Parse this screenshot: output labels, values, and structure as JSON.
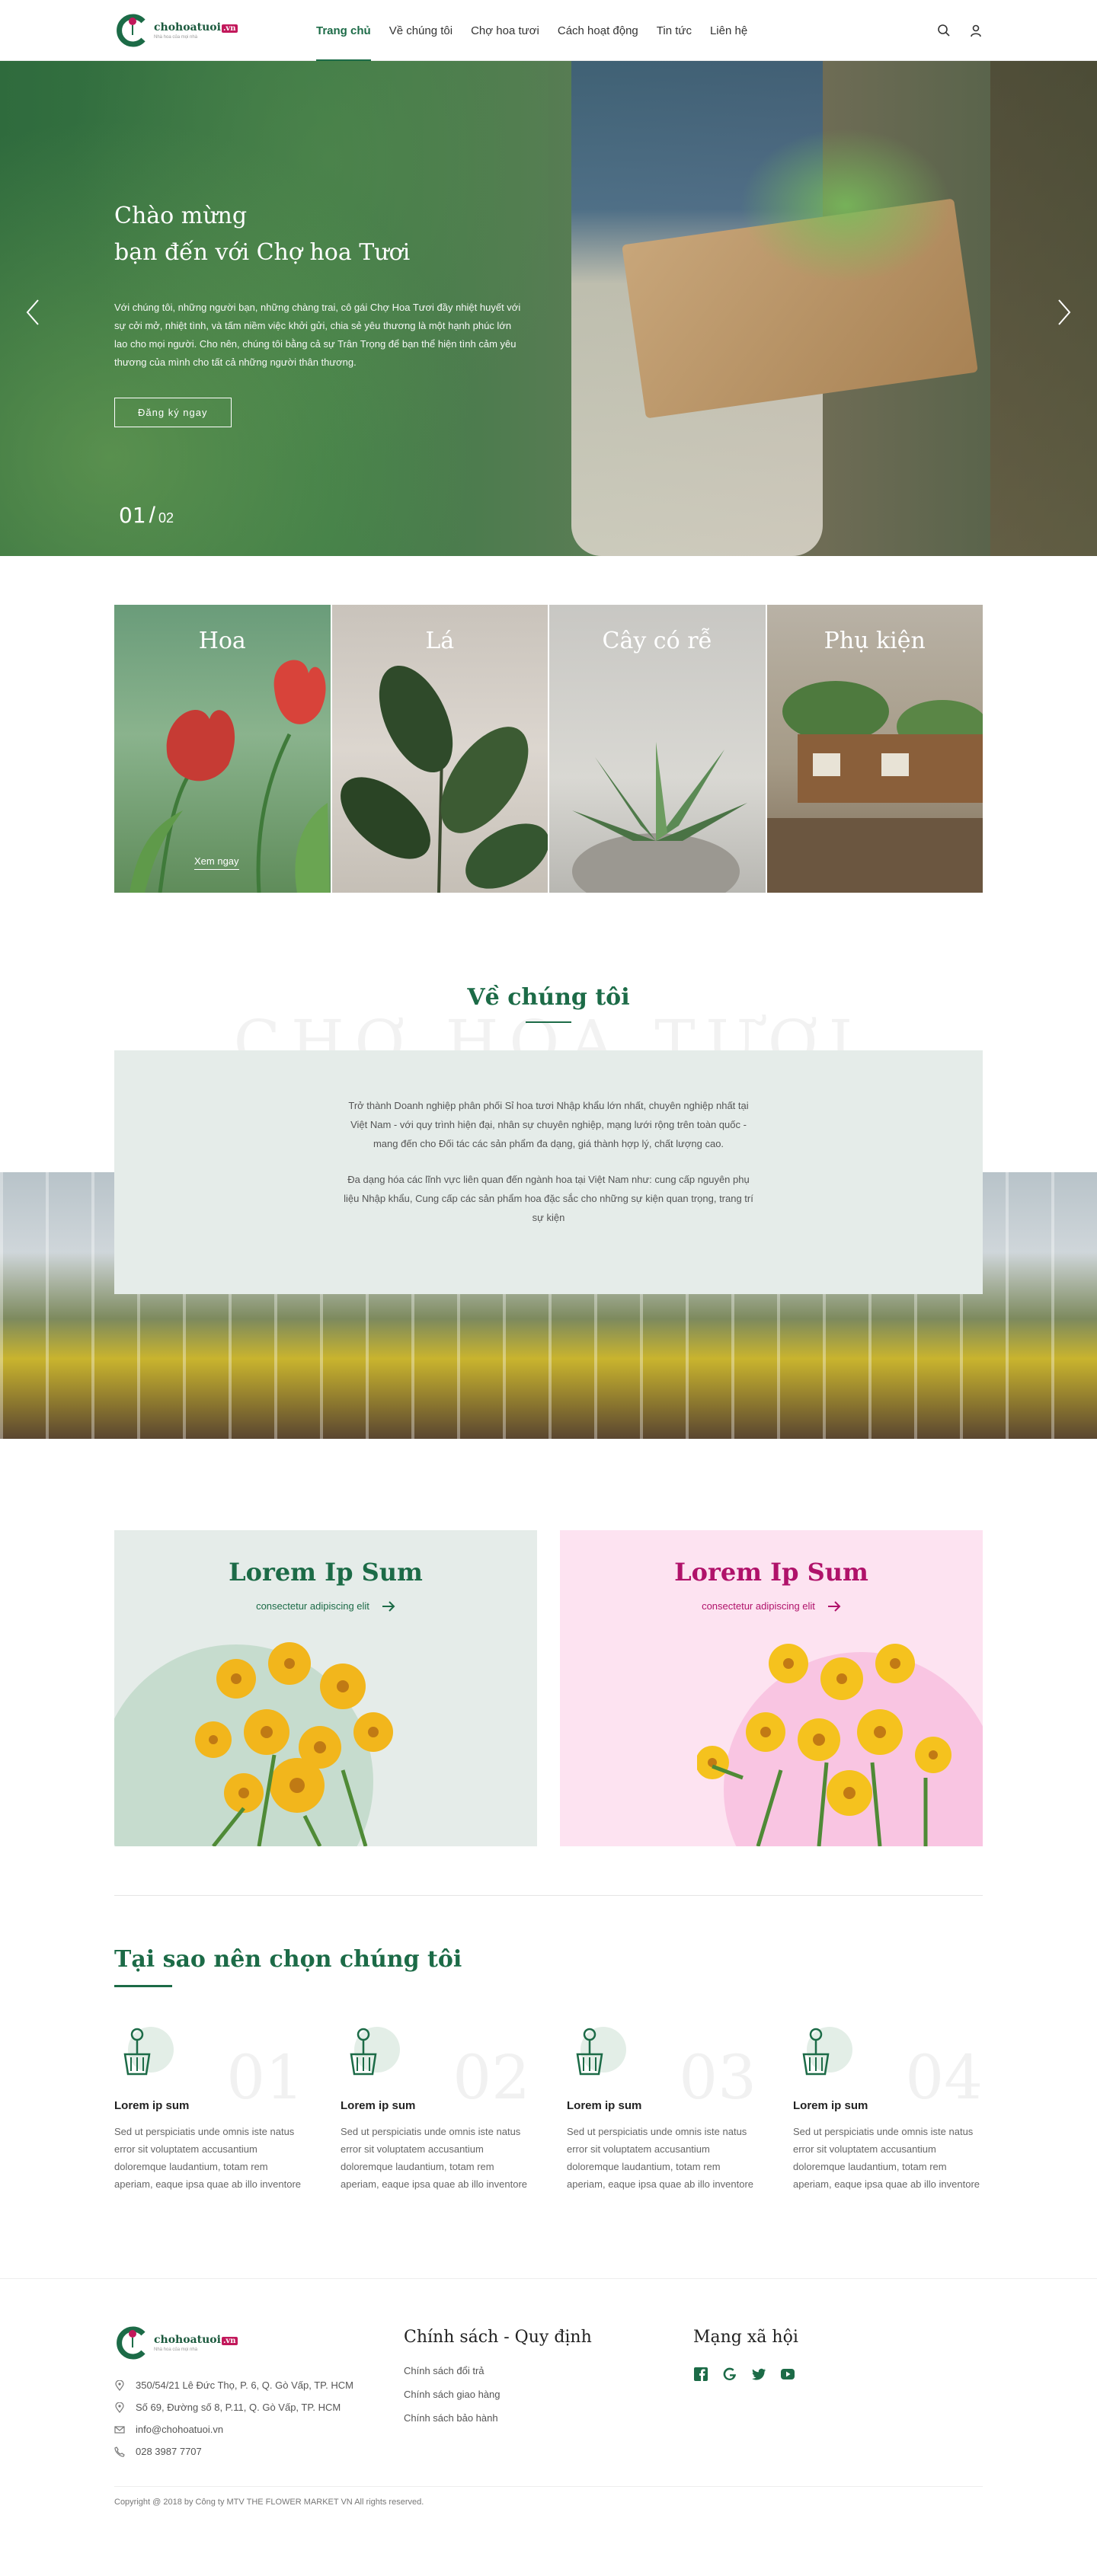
{
  "brand": {
    "name": "chohoatuoi",
    "tld": ".vn",
    "tagline": "Nhà hoa của mọi nhà",
    "colors": {
      "primary": "#1c6b47",
      "accent": "#c2185b"
    }
  },
  "nav": {
    "items": [
      "Trang chủ",
      "Về chúng tôi",
      "Chợ hoa tươi",
      "Cách hoạt động",
      "Tin tức",
      "Liên hệ"
    ],
    "active": "Trang chủ",
    "icons": [
      "search-icon",
      "user-icon"
    ]
  },
  "hero": {
    "title_line1": "Chào mừng",
    "title_line2": "bạn đến với Chợ hoa Tươi",
    "description": "Với chúng tôi, những người bạn, những chàng trai, cô gái Chợ Hoa Tươi đầy nhiệt huyết với sự cởi mở, nhiệt tình, và tấm niềm việc khởi gửi, chia sẻ yêu thương là một hạnh phúc lớn lao cho mọi người. Cho nên, chúng tôi bằng cả sự Trân Trọng để bạn thể hiện tình cảm yêu thương của mình cho tất cả những người thân thương.",
    "button": "Đăng ký ngay",
    "slide_current": "01",
    "slide_separator": "/",
    "slide_total": "02"
  },
  "categories": [
    {
      "name": "Hoa",
      "more": "Xem ngay"
    },
    {
      "name": "Lá"
    },
    {
      "name": "Cây có rễ"
    },
    {
      "name": "Phụ kiện"
    }
  ],
  "about": {
    "title": "Về chúng tôi",
    "watermark": "CHỢ HOA TƯƠI",
    "paragraph1": "Trở thành Doanh nghiệp phân phối Sỉ hoa tươi Nhập khẩu lớn nhất, chuyên nghiệp nhất tại Việt Nam - với quy trình hiện đại, nhân sự chuyên nghiệp, mạng lưới rộng trên toàn quốc - mang đến cho Đối tác các sản phẩm đa dạng, giá thành hợp lý, chất lượng cao.",
    "paragraph2": "Đa dạng hóa các lĩnh vực liên quan đến ngành hoa tại Việt Nam như: cung cấp nguyên phụ liệu Nhập khẩu, Cung cấp các sản phẩm hoa đặc sắc cho những sự kiện quan trọng, trang trí sự kiện"
  },
  "promos": [
    {
      "title": "Lorem Ip Sum",
      "subtitle": "consectetur adipiscing elit",
      "color": "#1c6b47"
    },
    {
      "title": "Lorem Ip Sum",
      "subtitle": "consectetur adipiscing elit",
      "color": "#b0126a"
    }
  ],
  "why": {
    "title": "Tại sao nên chọn chúng tôi",
    "items": [
      {
        "num": "01",
        "heading": "Lorem ip sum",
        "text": "Sed ut perspiciatis unde omnis iste natus error sit voluptatem accusantium doloremque laudantium, totam rem aperiam, eaque ipsa quae ab illo inventore"
      },
      {
        "num": "02",
        "heading": "Lorem ip sum",
        "text": "Sed ut perspiciatis unde omnis iste natus error sit voluptatem accusantium doloremque laudantium, totam rem aperiam, eaque ipsa quae ab illo inventore"
      },
      {
        "num": "03",
        "heading": "Lorem ip sum",
        "text": "Sed ut perspiciatis unde omnis iste natus error sit voluptatem accusantium doloremque laudantium, totam rem aperiam, eaque ipsa quae ab illo inventore"
      },
      {
        "num": "04",
        "heading": "Lorem ip sum",
        "text": "Sed ut perspiciatis unde omnis iste natus error sit voluptatem accusantium doloremque laudantium, totam rem aperiam, eaque ipsa quae ab illo inventore"
      }
    ]
  },
  "footer": {
    "contacts": [
      {
        "icon": "map-pin-icon",
        "text": "350/54/21 Lê Đức Thọ, P. 6, Q. Gò Vấp, TP. HCM"
      },
      {
        "icon": "map-pin-icon",
        "text": "Số 69, Đường số 8, P.11, Q. Gò Vấp, TP. HCM"
      },
      {
        "icon": "mail-icon",
        "text": "info@chohoatuoi.vn"
      },
      {
        "icon": "phone-icon",
        "text": "028 3987 7707"
      }
    ],
    "policy_title": "Chính sách - Quy định",
    "policies": [
      "Chính sách đổi trả",
      "Chính sách giao hàng",
      "Chính sách bảo hành"
    ],
    "social_title": "Mạng xã hội",
    "socials": [
      "facebook-icon",
      "google-icon",
      "twitter-icon",
      "youtube-icon"
    ],
    "copyright": "Copyright @ 2018 by Công ty MTV THE FLOWER MARKET VN All rights reserved."
  }
}
